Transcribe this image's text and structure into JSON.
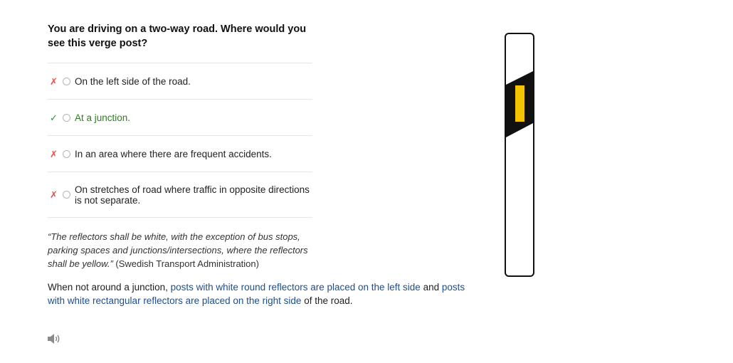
{
  "question": {
    "text": "You are driving on a two-way road. Where would you see this verge post?"
  },
  "options": [
    {
      "status": "wrong",
      "mark": "✗",
      "text": "On the left side of the road."
    },
    {
      "status": "correct",
      "mark": "✓",
      "text": "At a junction."
    },
    {
      "status": "wrong",
      "mark": "✗",
      "text": "In an area where there are frequent accidents."
    },
    {
      "status": "wrong",
      "mark": "✗",
      "text": "On stretches of road where traffic in opposite directions is not separate."
    }
  ],
  "quote": {
    "text": "“The reflectors shall be white, with the exception of bus stops, parking spaces and junctions/intersections, where the reflectors shall be yellow.”",
    "source": " (Swedish Transport Administration)"
  },
  "explanation": {
    "intro": "When not around a junction, ",
    "link1": "posts with white round reflectors are placed on the left side",
    "middle": " and ",
    "link2": "posts with white rectangular reflectors are placed on the right side",
    "outro": " of the road."
  },
  "icons": {
    "speaker": "speaker-icon",
    "verge_post": "verge-post-image"
  },
  "colors": {
    "wrong_mark": "#d9534f",
    "correct_mark": "#2e8b2e",
    "correct_text": "#2e7d1f",
    "link": "#1f4e8c",
    "reflector": "#f5c400"
  }
}
